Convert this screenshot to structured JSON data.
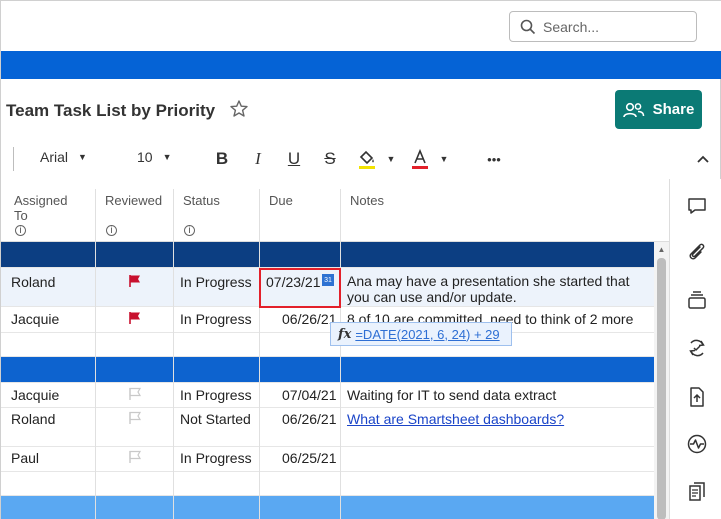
{
  "search": {
    "placeholder": "Search..."
  },
  "sheet": {
    "title": "Team Task List by Priority",
    "share_label": "Share"
  },
  "toolbar": {
    "font": "Arial",
    "size": "10",
    "more": "•••"
  },
  "columns": [
    {
      "label": "Assigned\nTo"
    },
    {
      "label": "Reviewed"
    },
    {
      "label": "Status"
    },
    {
      "label": "Due"
    },
    {
      "label": "Notes"
    }
  ],
  "rows": [
    {
      "assigned": "Roland",
      "status": "In Progress",
      "due": "07/23/21",
      "notes": "Ana may have a presentation she started that you can use and/or update.",
      "flag": "red"
    },
    {
      "assigned": "Jacquie",
      "status": "In Progress",
      "due": "06/26/21",
      "notes": "8 of 10 are committed, need to think of 2 more",
      "flag": "red"
    },
    {
      "assigned": "Jacquie",
      "status": "In Progress",
      "due": "07/04/21",
      "notes": "Waiting for IT to send data extract",
      "flag": "outline"
    },
    {
      "assigned": "Roland",
      "status": "Not Started",
      "due": "06/26/21",
      "notes": "What are Smartsheet dashboards?",
      "flag": "outline"
    },
    {
      "assigned": "Paul",
      "status": "In Progress",
      "due": "06/25/21",
      "notes": "",
      "flag": "outline"
    }
  ],
  "formula": {
    "text": "=DATE(2021, 6, 24) + 29",
    "label": "fx"
  },
  "calendar_day": "31",
  "colors": {
    "accent": "#0b7a75",
    "band_dark": "#0c3e82",
    "band_mid": "#0d63cf",
    "band_light": "#5aa8f2",
    "selection": "#e3202a"
  }
}
